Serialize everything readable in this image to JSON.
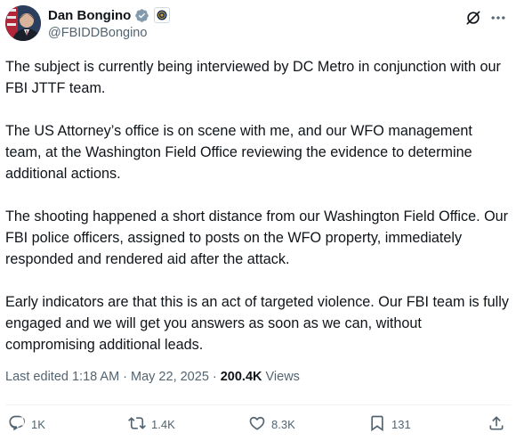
{
  "author": {
    "display_name": "Dan Bongino",
    "handle": "@FBIDDBongino"
  },
  "post": {
    "paragraphs": [
      "The subject is currently being interviewed by DC Metro in conjunction with our FBI JTTF team.",
      "The US Attorney’s office is on scene with me, and our WFO management team, at the Washington Field Office reviewing the evidence to determine additional actions.",
      "The shooting happened a short distance from our Washington Field Office. Our FBI police officers, assigned to posts on the WFO property, immediately responded and rendered aid after the attack.",
      "Early indicators are that this is an act of targeted violence. Our FBI team is fully engaged and we will get you answers as soon as we can, without compromising additional leads."
    ],
    "edited_label": "Last edited 1:18 AM",
    "separator": "·",
    "date": "May 22, 2025",
    "views_count": "200.4K",
    "views_label": "Views"
  },
  "actions": {
    "replies": "1K",
    "reposts": "1.4K",
    "likes": "8.3K",
    "bookmarks": "131"
  },
  "icons": {
    "verified": "verified-badge-icon",
    "affiliation": "fbi-seal-icon",
    "grok": "grok-icon",
    "more": "more-icon",
    "reply": "reply-icon",
    "repost": "repost-icon",
    "like": "heart-icon",
    "bookmark": "bookmark-icon",
    "share": "share-icon"
  },
  "colors": {
    "text": "#0f1419",
    "secondary": "#536471",
    "verified": "#829aab"
  }
}
